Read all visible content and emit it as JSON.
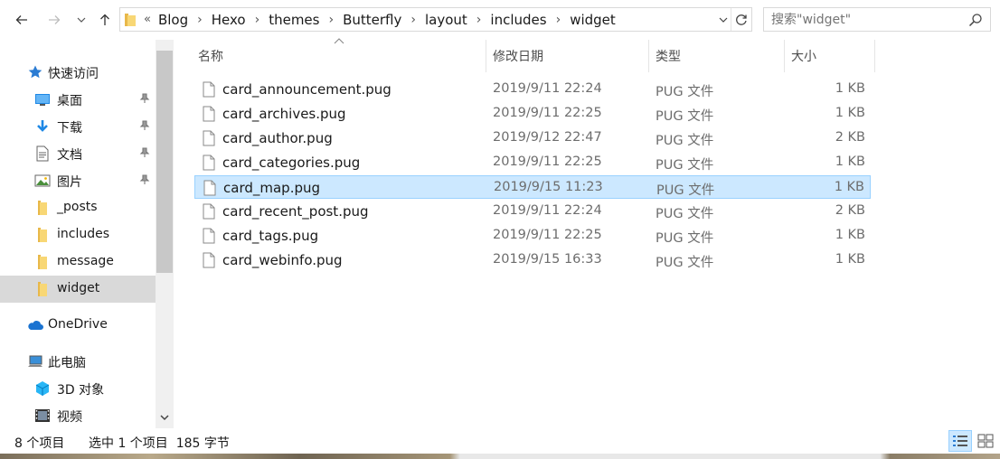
{
  "address": {
    "overflow": "«",
    "crumbs": [
      "Blog",
      "Hexo",
      "themes",
      "Butterfly",
      "layout",
      "includes",
      "widget"
    ]
  },
  "search": {
    "placeholder": "搜索\"widget\""
  },
  "nav": {
    "quick_access": "快速访问",
    "items": [
      {
        "label": "桌面",
        "icon": "desktop-icon",
        "pinned": true
      },
      {
        "label": "下载",
        "icon": "download-icon",
        "pinned": true
      },
      {
        "label": "文档",
        "icon": "document-icon",
        "pinned": true
      },
      {
        "label": "图片",
        "icon": "pictures-icon",
        "pinned": true
      },
      {
        "label": "_posts",
        "icon": "folder-icon",
        "pinned": false
      },
      {
        "label": "includes",
        "icon": "folder-icon",
        "pinned": false
      },
      {
        "label": "message",
        "icon": "folder-icon",
        "pinned": false
      },
      {
        "label": "widget",
        "icon": "folder-icon",
        "pinned": false,
        "selected": true
      }
    ],
    "onedrive": "OneDrive",
    "this_pc": "此电脑",
    "pc_items": [
      {
        "label": "3D 对象",
        "icon": "3d-objects-icon"
      },
      {
        "label": "视频",
        "icon": "video-icon"
      }
    ]
  },
  "columns": {
    "name": "名称",
    "date": "修改日期",
    "type": "类型",
    "size": "大小"
  },
  "files": [
    {
      "name": "card_announcement.pug",
      "date": "2019/9/11 22:24",
      "type": "PUG 文件",
      "size": "1 KB"
    },
    {
      "name": "card_archives.pug",
      "date": "2019/9/11 22:25",
      "type": "PUG 文件",
      "size": "1 KB"
    },
    {
      "name": "card_author.pug",
      "date": "2019/9/12 22:47",
      "type": "PUG 文件",
      "size": "2 KB"
    },
    {
      "name": "card_categories.pug",
      "date": "2019/9/11 22:25",
      "type": "PUG 文件",
      "size": "1 KB"
    },
    {
      "name": "card_map.pug",
      "date": "2019/9/15 11:23",
      "type": "PUG 文件",
      "size": "1 KB",
      "selected": true
    },
    {
      "name": "card_recent_post.pug",
      "date": "2019/9/11 22:24",
      "type": "PUG 文件",
      "size": "2 KB"
    },
    {
      "name": "card_tags.pug",
      "date": "2019/9/11 22:25",
      "type": "PUG 文件",
      "size": "1 KB"
    },
    {
      "name": "card_webinfo.pug",
      "date": "2019/9/15 16:33",
      "type": "PUG 文件",
      "size": "1 KB"
    }
  ],
  "status": {
    "count": "8 个项目",
    "selection": "选中 1 个项目  185 字节"
  },
  "colors": {
    "selection_bg": "#cce8ff",
    "selection_border": "#99d1ff",
    "nav_selected": "#d9d9d9",
    "folder": "#f8d775",
    "accent": "#0078d7"
  }
}
